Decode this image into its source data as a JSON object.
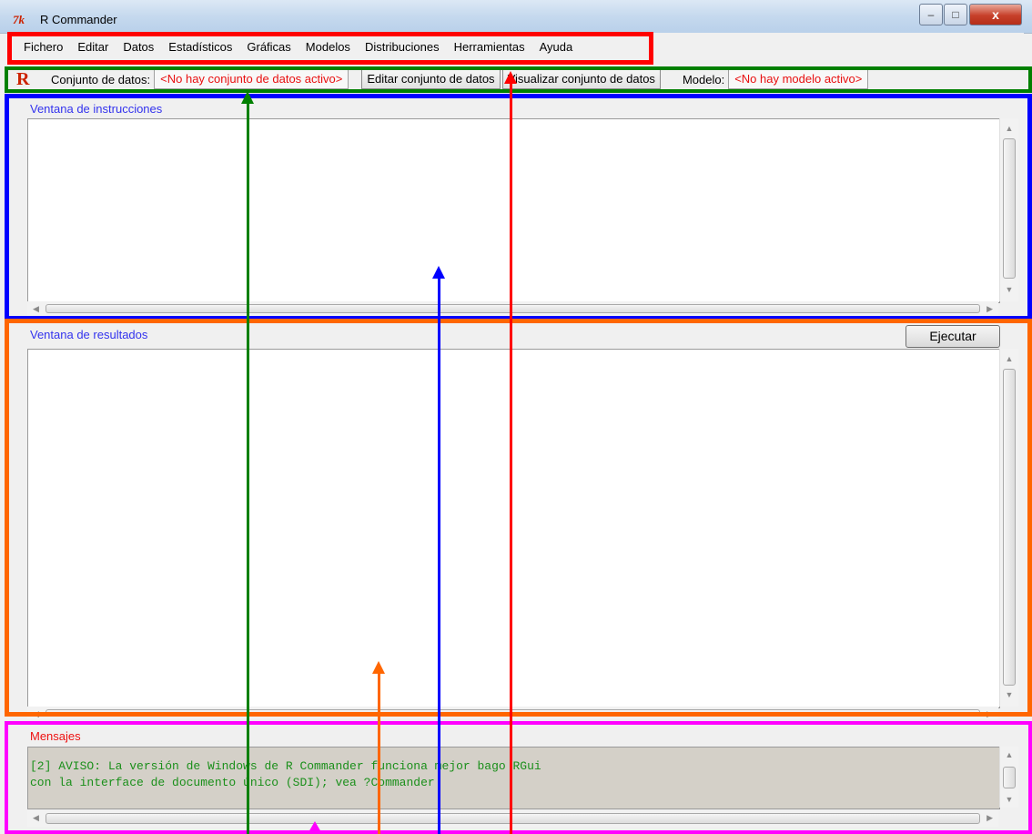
{
  "window": {
    "title": "R Commander",
    "icon_glyph": "7k",
    "controls": {
      "minimize": "–",
      "maximize": "□",
      "close": "x"
    }
  },
  "menu": [
    "Fichero",
    "Editar",
    "Datos",
    "Estadísticos",
    "Gráficas",
    "Modelos",
    "Distribuciones",
    "Herramientas",
    "Ayuda"
  ],
  "toolbar": {
    "logo": "R",
    "dataset_label": "Conjunto de datos:",
    "dataset_value": "<No hay conjunto de datos activo>",
    "edit_dataset": "Editar conjunto de datos",
    "view_dataset": "Visualizar conjunto de datos",
    "model_label": "Modelo:",
    "model_value": "<No hay modelo activo>"
  },
  "script_window": {
    "label": "Ventana de instrucciones",
    "content": ""
  },
  "output_window": {
    "label": "Ventana de resultados",
    "content": "",
    "run_button": "Ejecutar"
  },
  "messages": {
    "label": "Mensajes",
    "lines": [
      "[2] AVISO: La versión de Windows de R Commander funciona mejor bago RGui",
      "con la interface de documento único (SDI); vea ?Commander"
    ]
  },
  "colors": {
    "annotation_menu": "#ff0000",
    "annotation_toolbar": "#008000",
    "annotation_script": "#0000ff",
    "annotation_output": "#ff6600",
    "annotation_messages": "#ff00ff",
    "dataset_text": "#e81010",
    "panel_label": "#3333ee",
    "messages_label": "#ee1111",
    "messages_text": "#1a8f1a"
  }
}
